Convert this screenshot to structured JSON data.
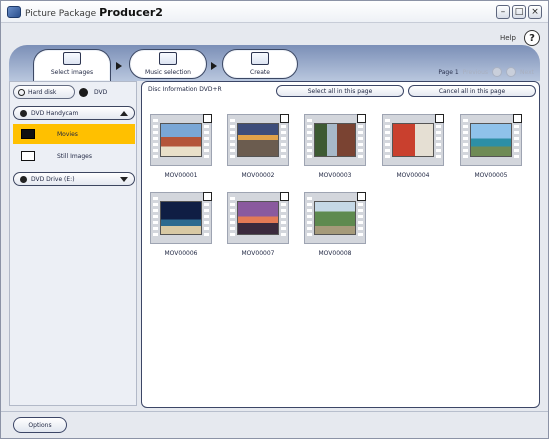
{
  "window": {
    "title_prefix": "Picture Package",
    "title_bold": "Producer2",
    "controls": {
      "minimize": "–",
      "restore": "□",
      "close": "×"
    }
  },
  "help": {
    "label": "Help",
    "icon": "?"
  },
  "tabs": [
    {
      "label": "Select images"
    },
    {
      "label": "Music selection"
    },
    {
      "label": "Create"
    }
  ],
  "pager": {
    "page_label": "Page 1",
    "previous": "Previous",
    "next": "Next"
  },
  "sidebar": {
    "hard_disk": "Hard disk",
    "dvd": "DVD",
    "dvd_handycam": "DVD Handycam",
    "items": [
      {
        "label": "Movies",
        "selected": true
      },
      {
        "label": "Still Images",
        "selected": false
      }
    ],
    "drive": "DVD Drive (E:)"
  },
  "main": {
    "disc_info": "Disc Information DVD+R",
    "select_all": "Select all in this page",
    "cancel_all": "Cancel all in this page"
  },
  "thumbnails": [
    {
      "label": "MOV00001"
    },
    {
      "label": "MOV00002"
    },
    {
      "label": "MOV00003"
    },
    {
      "label": "MOV00004"
    },
    {
      "label": "MOV00005"
    },
    {
      "label": "MOV00006"
    },
    {
      "label": "MOV00007"
    },
    {
      "label": "MOV00008"
    }
  ],
  "footer": {
    "options": "Options"
  },
  "colors": {
    "selection": "#ffc000",
    "tab_strip": "#7b8fb7"
  },
  "icons": [
    "app-icon",
    "help-icon",
    "harddisk-icon",
    "dvd-icon",
    "movie-icon",
    "still-image-icon",
    "disc-icon",
    "caret-up-icon",
    "caret-down-icon"
  ]
}
